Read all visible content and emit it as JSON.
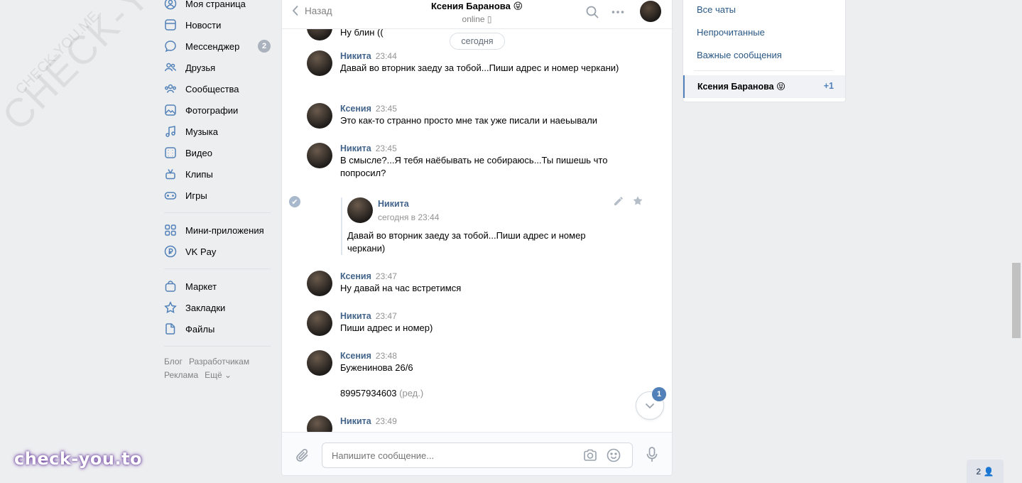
{
  "watermark": {
    "big": "CHECK-YOU.ME",
    "small": "CHECK-YOU.ME",
    "brand": "check-you.to"
  },
  "nav": {
    "items": [
      {
        "label": "Моя страница",
        "icon": "profile-icon"
      },
      {
        "label": "Новости",
        "icon": "news-icon"
      },
      {
        "label": "Мессенджер",
        "icon": "messenger-icon",
        "count": "2"
      },
      {
        "label": "Друзья",
        "icon": "friends-icon"
      },
      {
        "label": "Сообщества",
        "icon": "communities-icon"
      },
      {
        "label": "Фотографии",
        "icon": "photos-icon"
      },
      {
        "label": "Музыка",
        "icon": "music-icon"
      },
      {
        "label": "Видео",
        "icon": "video-icon"
      },
      {
        "label": "Клипы",
        "icon": "clips-icon"
      },
      {
        "label": "Игры",
        "icon": "games-icon"
      }
    ],
    "items2": [
      {
        "label": "Мини-приложения",
        "icon": "mini-apps-icon"
      },
      {
        "label": "VK Pay",
        "icon": "vkpay-icon"
      }
    ],
    "items3": [
      {
        "label": "Маркет",
        "icon": "market-icon"
      },
      {
        "label": "Закладки",
        "icon": "bookmarks-icon"
      },
      {
        "label": "Файлы",
        "icon": "files-icon"
      }
    ],
    "footer": {
      "blog": "Блог",
      "dev": "Разработчикам",
      "ads": "Реклама",
      "more": "Ещё ⌄"
    }
  },
  "chat": {
    "back_label": "Назад",
    "peer_name": "Ксения Баранова 😝",
    "peer_status": "online ▯",
    "date_pill": "сегодня",
    "top_cut_text": "Ну блин ((",
    "messages": [
      {
        "author": "Никита",
        "time": "23:44",
        "text": "Давай во вторник заеду за тобой...Пиши адрес и номер черкани)"
      },
      {
        "author": "Ксения",
        "time": "23:45",
        "text": "Это как-то странно просто мне так уже писали и наеьывали"
      },
      {
        "author": "Никита",
        "time": "23:45",
        "text": "В смысле?...Я тебя наёбывать не собираюсь...Ты пишешь что попросил?"
      },
      {
        "author": "Ксения",
        "time": "23:47",
        "text": "Ну давай на час встретимся"
      },
      {
        "author": "Никита",
        "time": "23:47",
        "text": "Пиши адрес и номер)"
      },
      {
        "author": "Ксения",
        "time": "23:48",
        "text": "Буженинова 26/6",
        "text2": "89957934603",
        "edited": "(ред.)"
      },
      {
        "author": "Никита",
        "time": "23:49",
        "text": ""
      }
    ],
    "forwarded": {
      "author": "Никита",
      "date": "сегодня в 23:44",
      "text": "Давай во вторник заеду за тобой...Пиши адрес и номер черкани)"
    },
    "scroll_badge": "1",
    "compose_placeholder": "Напишите сообщение..."
  },
  "right_panel": {
    "all_chats": "Все чаты",
    "unread": "Непрочитанные",
    "important": "Важные сообщения",
    "selected_chat": "Ксения Баранова 😝",
    "selected_count": "+1"
  },
  "online_count": "2 👤",
  "colors": {
    "accent": "#5181b8",
    "link": "#2a5885",
    "author": "#42648b",
    "bg": "#edeef0"
  }
}
